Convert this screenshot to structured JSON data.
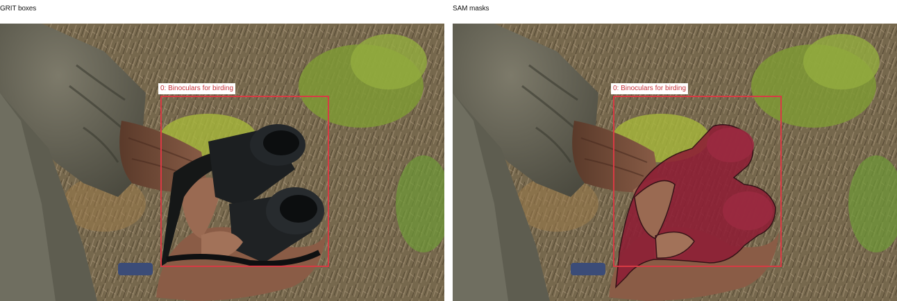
{
  "panels": {
    "left": {
      "title": "GRIT boxes"
    },
    "right": {
      "title": "SAM masks"
    }
  },
  "detections": [
    {
      "index": 0,
      "label": "0: Binoculars for birding"
    }
  ],
  "colors": {
    "box_stroke": "#d93a44",
    "label_text": "#c43139",
    "mask_fill": "#8e1e35"
  }
}
